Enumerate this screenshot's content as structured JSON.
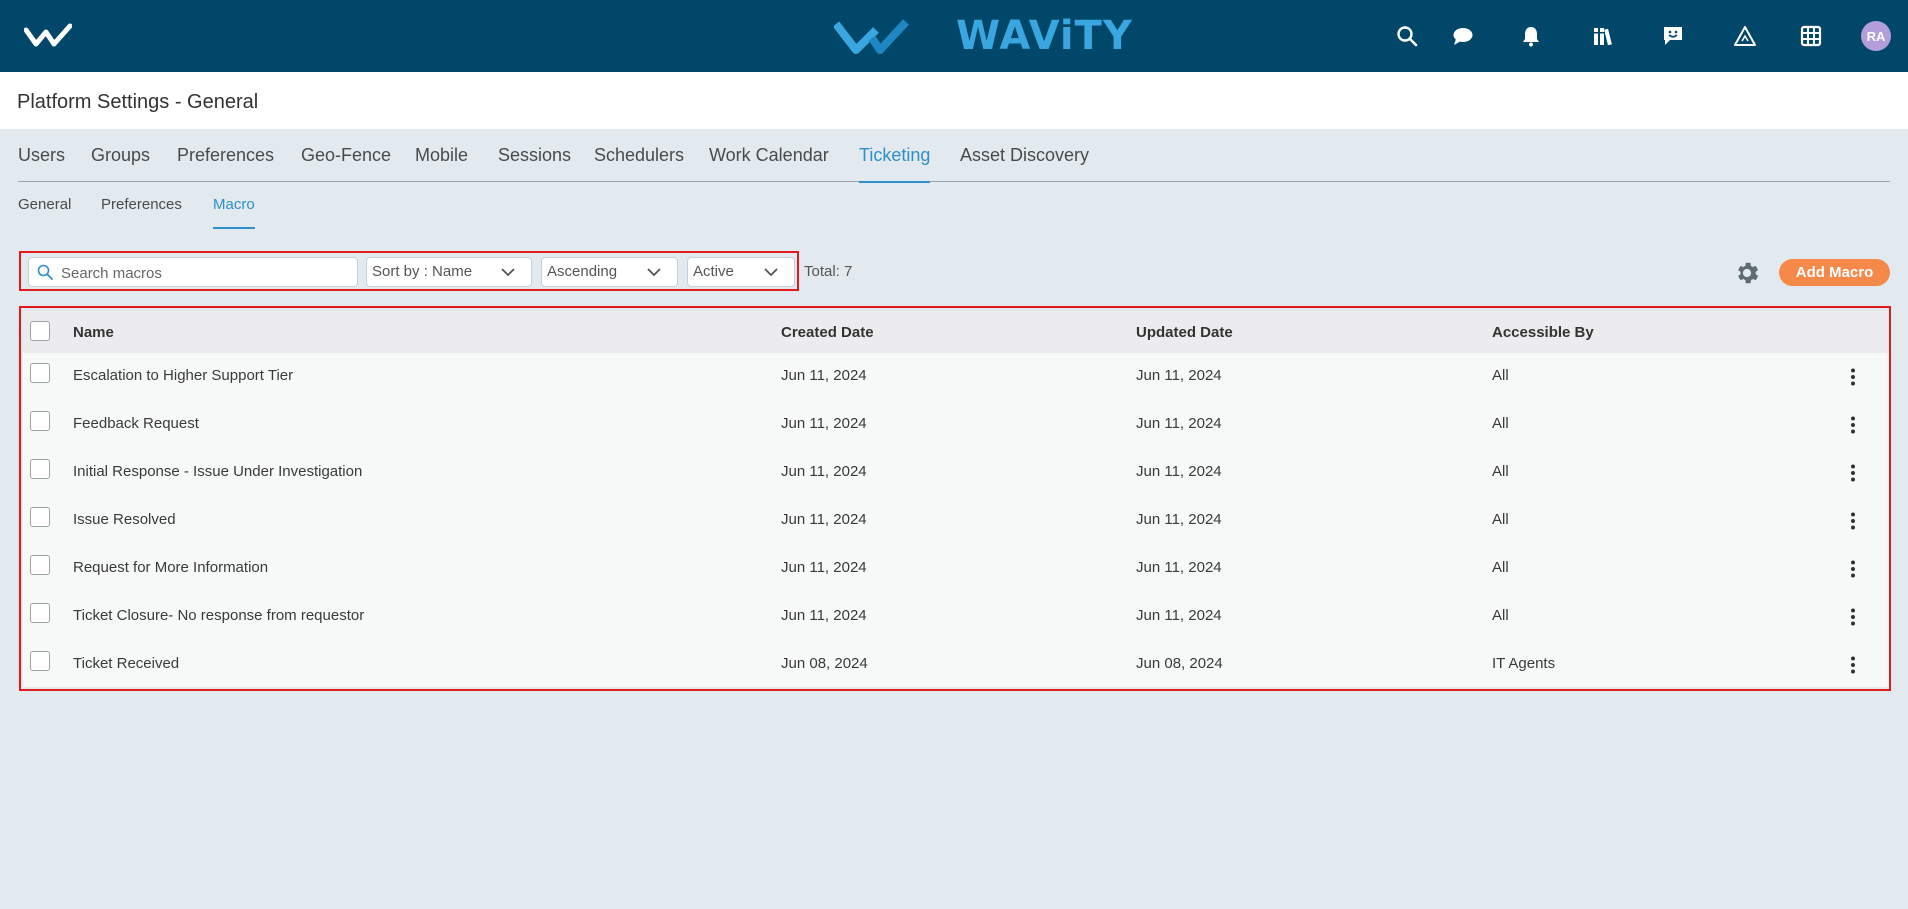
{
  "topbar": {
    "brand": "WAViTY",
    "icons": [
      "search-icon",
      "chat-icon",
      "bell-icon",
      "library-icon",
      "feedback-icon",
      "alert-triangle-icon",
      "grid-icon"
    ],
    "avatar_initials": "RA",
    "colors": {
      "bar": "#01476a",
      "brand": "#3aa6df",
      "avatar": "#b39ddb"
    }
  },
  "page": {
    "title": "Platform Settings - General"
  },
  "main_tabs": [
    "Users",
    "Groups",
    "Preferences",
    "Geo-Fence",
    "Mobile",
    "Sessions",
    "Schedulers",
    "Work Calendar",
    "Ticketing",
    "Asset Discovery"
  ],
  "main_tab_active": "Ticketing",
  "sub_tabs": [
    "General",
    "Preferences",
    "Macro"
  ],
  "sub_tab_active": "Macro",
  "filters": {
    "search_placeholder": "Search macros",
    "sort": "Sort by : Name",
    "order": "Ascending",
    "status": "Active"
  },
  "total": "Total: 7",
  "add_button": "Add Macro",
  "table": {
    "headers": {
      "name": "Name",
      "created": "Created Date",
      "updated": "Updated Date",
      "accessible": "Accessible By"
    },
    "rows": [
      {
        "name": "Escalation to Higher Support Tier",
        "created": "Jun 11, 2024",
        "updated": "Jun 11, 2024",
        "accessible": "All"
      },
      {
        "name": "Feedback Request",
        "created": "Jun 11, 2024",
        "updated": "Jun 11, 2024",
        "accessible": "All"
      },
      {
        "name": "Initial Response - Issue Under Investigation",
        "created": "Jun 11, 2024",
        "updated": "Jun 11, 2024",
        "accessible": "All"
      },
      {
        "name": "Issue Resolved",
        "created": "Jun 11, 2024",
        "updated": "Jun 11, 2024",
        "accessible": "All"
      },
      {
        "name": "Request for More Information",
        "created": "Jun 11, 2024",
        "updated": "Jun 11, 2024",
        "accessible": "All"
      },
      {
        "name": "Ticket Closure- No response from requestor",
        "created": "Jun 11, 2024",
        "updated": "Jun 11, 2024",
        "accessible": "All"
      },
      {
        "name": "Ticket Received",
        "created": "Jun 08, 2024",
        "updated": "Jun 08, 2024",
        "accessible": "IT Agents"
      }
    ]
  },
  "accent_color": "#2e8fc9",
  "button_color": "#f5894a",
  "highlight_color": "#e01a1a"
}
